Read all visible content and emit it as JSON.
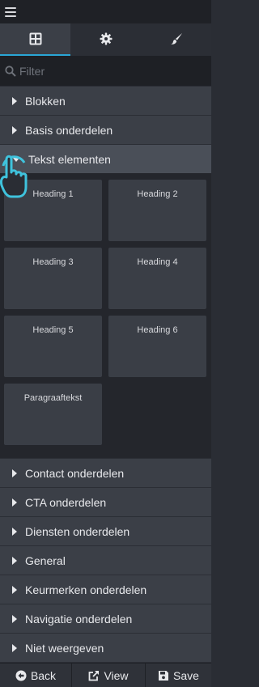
{
  "tabs": [
    {
      "icon": "grid-icon"
    },
    {
      "icon": "gear-icon"
    },
    {
      "icon": "brush-icon"
    }
  ],
  "filter": {
    "placeholder": "Filter"
  },
  "categories_top": [
    {
      "label": "Blokken"
    },
    {
      "label": "Basis onderdelen"
    },
    {
      "label": "Tekst elementen"
    }
  ],
  "tiles": [
    {
      "label": "Heading 1"
    },
    {
      "label": "Heading 2"
    },
    {
      "label": "Heading 3"
    },
    {
      "label": "Heading 4"
    },
    {
      "label": "Heading 5"
    },
    {
      "label": "Heading 6"
    },
    {
      "label": "Paragraaftekst"
    }
  ],
  "categories_bottom": [
    {
      "label": "Contact onderdelen"
    },
    {
      "label": "CTA onderdelen"
    },
    {
      "label": "Diensten onderdelen"
    },
    {
      "label": "General"
    },
    {
      "label": "Keurmerken onderdelen"
    },
    {
      "label": "Navigatie onderdelen"
    },
    {
      "label": "Niet weergeven"
    }
  ],
  "footer": {
    "back": "Back",
    "view": "View",
    "save": "Save"
  },
  "colors": {
    "accent": "#2aa6d6",
    "panel": "#3b3f47",
    "background": "#2a2d34"
  }
}
